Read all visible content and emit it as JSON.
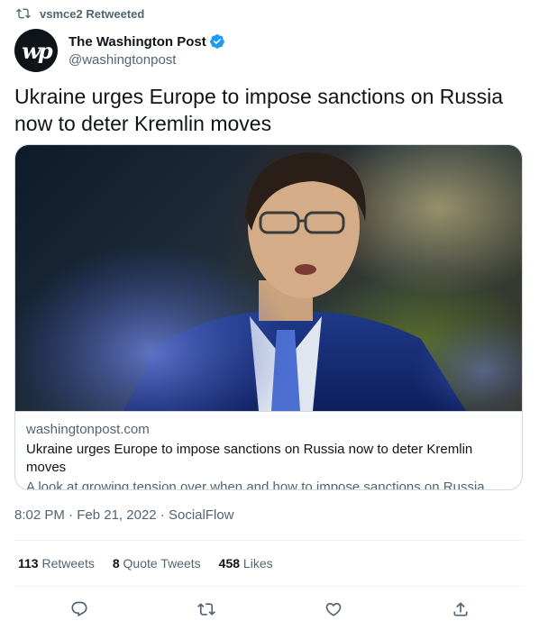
{
  "retweet": {
    "label": "vsmce2 Retweeted",
    "icon": "retweet-icon"
  },
  "author": {
    "avatar_text": "wp",
    "display_name": "The Washington Post",
    "handle": "@washingtonpost",
    "verified_icon": "verified-badge-icon",
    "verified_color": "#1d9bf0"
  },
  "tweet": {
    "text": "Ukraine urges Europe to impose sanctions on Russia now to deter Kremlin moves"
  },
  "card": {
    "image_icon": "article-photo-man-in-suit",
    "domain": "washingtonpost.com",
    "title": "Ukraine urges Europe to impose sanctions on Russia now to deter Kremlin moves",
    "description": "A look at growing tension over when and how to impose sanctions on Russia."
  },
  "meta": {
    "time": "8:02 PM",
    "date": "Feb 21, 2022",
    "source": "SocialFlow",
    "separator": "·"
  },
  "stats": {
    "retweets_count": "113",
    "retweets_label": "Retweets",
    "quotes_count": "8",
    "quotes_label": "Quote Tweets",
    "likes_count": "458",
    "likes_label": "Likes"
  },
  "actions": {
    "reply_icon": "reply-icon",
    "retweet_icon": "retweet-icon",
    "like_icon": "heart-icon",
    "share_icon": "share-icon"
  },
  "colors": {
    "text_primary": "#0f1419",
    "text_secondary": "#536471",
    "border": "#cfd9de",
    "accent": "#1d9bf0"
  }
}
